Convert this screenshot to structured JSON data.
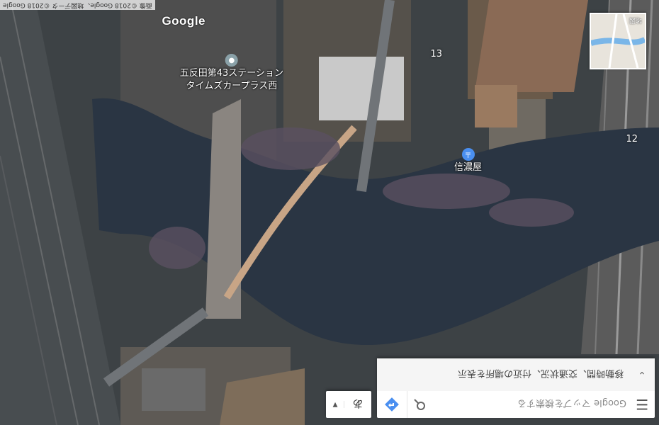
{
  "search": {
    "placeholder": "Google マップを検索する",
    "menu_icon": "menu-icon",
    "search_icon": "search-icon",
    "directions_icon": "directions-icon"
  },
  "expand": {
    "text": "移動時間、交通状況、付近の場所を表示"
  },
  "language": {
    "ime": "あ"
  },
  "minimap": {
    "label": "地図"
  },
  "logo": "Google",
  "copyright": "画像 ©2018 Google、地図データ ©2018 Google",
  "pois": {
    "post_office": "信濃屋",
    "hotel": [
      "タイムズカープラス西",
      "五反田第43ステーション"
    ]
  },
  "road_labels": {
    "a": "12",
    "b": "13"
  },
  "colors": {
    "water": "#2a3543",
    "pin_blue": "#4a8ff0",
    "pin_gray": "#8aa1a8"
  }
}
